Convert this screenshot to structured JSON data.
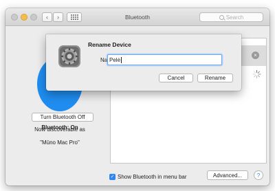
{
  "window": {
    "title": "Bluetooth",
    "search_placeholder": "Search",
    "nav_back_icon": "‹",
    "nav_forward_icon": "›"
  },
  "left_panel": {
    "status": "Bluetooth: On",
    "toggle_button": "Turn Bluetooth Off",
    "discoverable_line1": "Now discoverable as",
    "discoverable_line2": "\"Mūno Mac Pro\""
  },
  "device_list": {
    "remove_icon": "×"
  },
  "footer": {
    "checkbox_mark": "✓",
    "show_in_menu_bar": "Show Bluetooth in menu bar",
    "show_in_menu_bar_checked": true,
    "advanced_button": "Advanced...",
    "help_button": "?"
  },
  "rename_sheet": {
    "title": "Rename Device",
    "name_label": "Name:",
    "name_value": "Pelė",
    "cancel_button": "Cancel",
    "rename_button": "Rename"
  },
  "colors": {
    "accent": "#2f86f2",
    "bluetooth_blue": "#1f8df0",
    "window_bg": "#ececec",
    "traffic_light_minimize": "#f5bd4f"
  }
}
